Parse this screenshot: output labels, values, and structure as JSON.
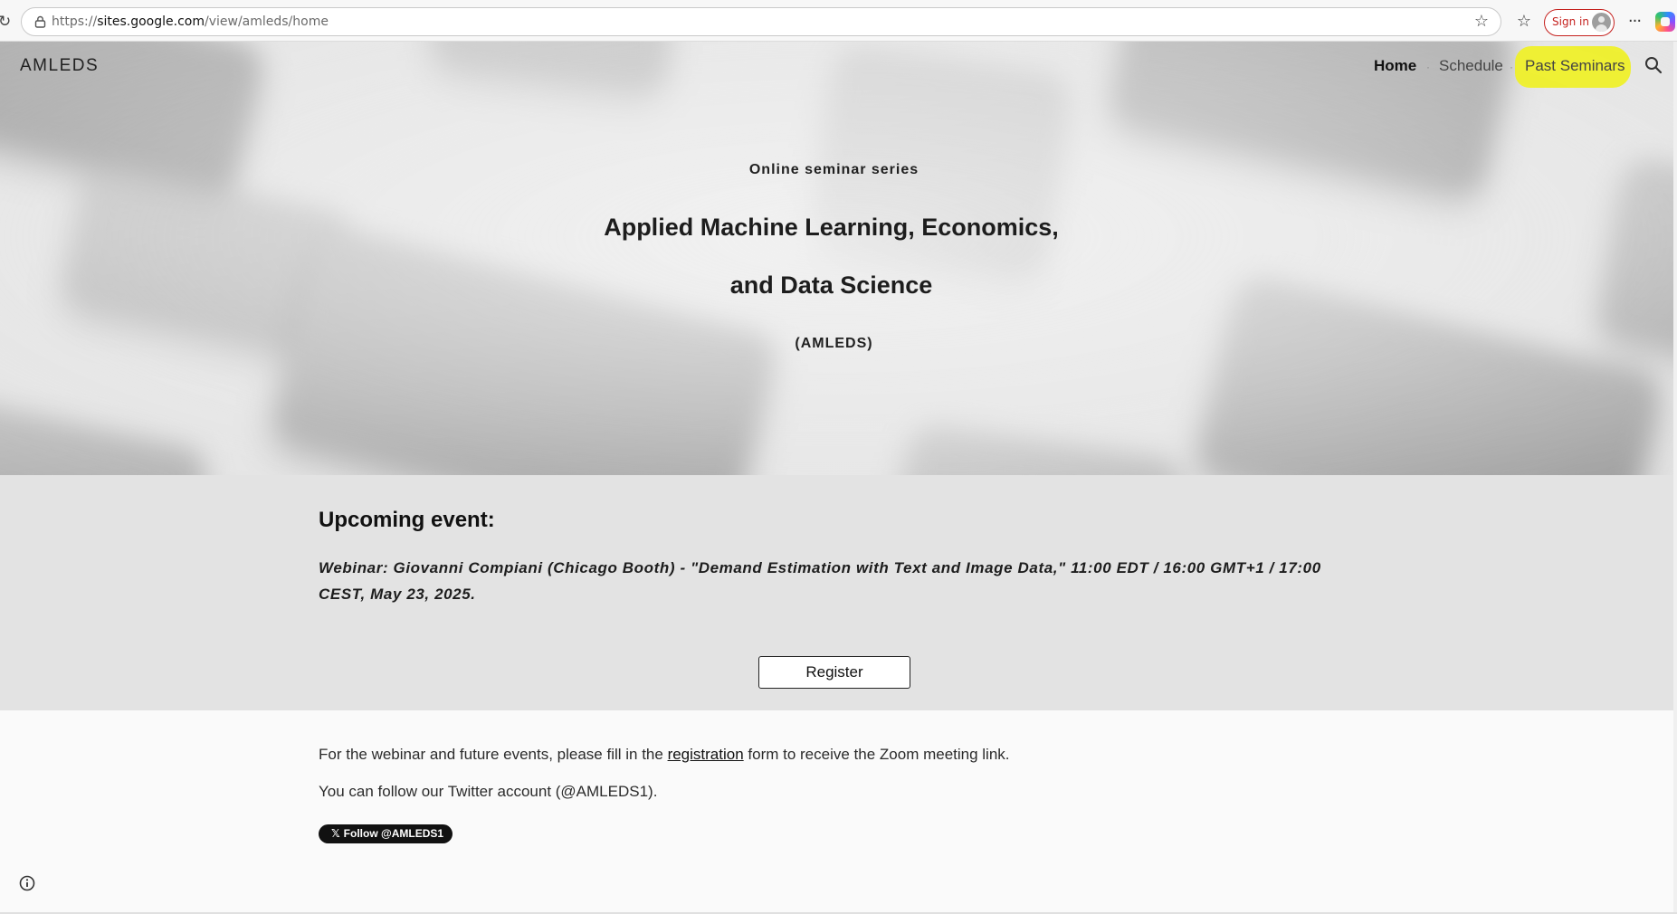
{
  "browser": {
    "url_prefix": "https://",
    "url_domain": "sites.google.com",
    "url_path": "/view/amleds/home",
    "sign_in_label": "Sign in",
    "reload_icon": "reload-icon",
    "lock_icon": "lock-icon",
    "star_icon": "star-icon",
    "favorites_icon": "favorites-icon",
    "more_icon": "more-icon",
    "copilot_icon": "copilot-icon"
  },
  "site": {
    "name": "AMLEDS",
    "nav": {
      "home": "Home",
      "schedule": "Schedule",
      "past_seminars": "Past Seminars",
      "separator": "·"
    },
    "highlight_color": "#eff02a"
  },
  "hero": {
    "eyebrow": "Online seminar series",
    "title_line1": "Applied Machine Learning, Economics,",
    "title_line2": "and Data Science",
    "acronym": "(AMLEDS)"
  },
  "upcoming": {
    "heading": "Upcoming event:",
    "details": "Webinar: Giovanni Compiani (Chicago Booth) - \"Demand Estimation with Text and Image Data,\" 11:00 EDT / 16:00 GMT+1 / 17:00 CEST, May 23, 2025.",
    "register_label": "Register"
  },
  "body": {
    "para1_before": "For the webinar and future events, please fill in the ",
    "para1_link": "registration",
    "para1_after": " form to receive the Zoom meeting link.",
    "para2": "You can follow our Twitter account (@AMLEDS1).",
    "follow_x": "𝕏",
    "follow_label": "Follow @AMLEDS1"
  }
}
